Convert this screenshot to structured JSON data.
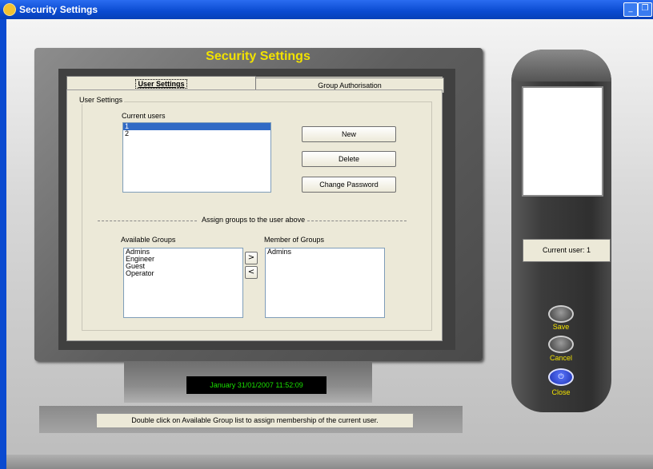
{
  "window": {
    "title": "Security Settings",
    "minimize_icon": "minimize-icon",
    "restore_icon": "restore-icon"
  },
  "screen": {
    "title": "Security Settings"
  },
  "tabs": [
    {
      "label": "User Settings"
    },
    {
      "label": "Group Authorisation"
    }
  ],
  "user_settings": {
    "group_label": "User Settings",
    "current_users_label": "Current users",
    "users": [
      "1",
      "2"
    ],
    "selected_user_index": 0,
    "buttons": {
      "new": "New",
      "delete": "Delete",
      "change_password": "Change Password"
    },
    "assign_label": "Assign groups to the user above",
    "available_groups_label": "Available Groups",
    "available_groups": [
      "Admins",
      "Engineer",
      "Guest",
      "Operator"
    ],
    "member_of_groups_label": "Member of Groups",
    "member_of_groups": [
      "Admins"
    ],
    "add_button": ">",
    "remove_button": "<"
  },
  "clock": {
    "text": "January  31/01/2007 11:52:09"
  },
  "status": {
    "text": "Double click on Available Group list to assign membership of the current user."
  },
  "side_panel": {
    "current_user": "Current user: 1",
    "save_label": "Save",
    "cancel_label": "Cancel",
    "close_label": "Close",
    "close_icon": "power-icon"
  },
  "colors": {
    "titlebar": "#0a4ad0",
    "accent_yellow": "#f2e200",
    "clock_green": "#19e000",
    "selection": "#316ac5"
  }
}
